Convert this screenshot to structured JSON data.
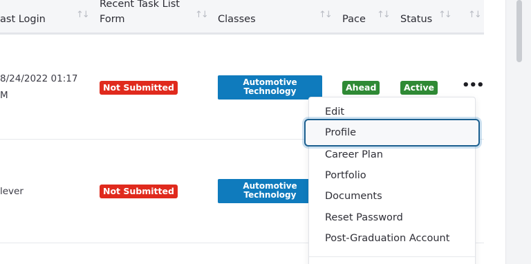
{
  "table": {
    "columns": [
      {
        "label": "ast Login"
      },
      {
        "label_line1": "Recent Task List",
        "label_line2": "Form"
      },
      {
        "label": "Classes"
      },
      {
        "label": "Pace"
      },
      {
        "label": "Status"
      }
    ],
    "rows": [
      {
        "last_login_line1": "8/24/2022 01:17",
        "last_login_line2": "M",
        "task_form": "Not Submitted",
        "class_line1": "Automotive",
        "class_line2": "Technology",
        "pace": "Ahead",
        "status": "Active"
      },
      {
        "last_login": "lever",
        "task_form": "Not Submitted",
        "class_line1": "Automotive",
        "class_line2": "Technology"
      }
    ]
  },
  "actions_menu": {
    "items": [
      {
        "label": "Edit"
      },
      {
        "label": "Profile"
      },
      {
        "label": "Career Plan"
      },
      {
        "label": "Portfolio"
      },
      {
        "label": "Documents"
      },
      {
        "label": "Reset Password"
      },
      {
        "label": "Post-Graduation Account"
      }
    ],
    "focused_item": "Profile"
  },
  "sort_glyph": "↑↓",
  "more_glyph": "•••",
  "icons": {
    "sort": "sort-arrows-icon",
    "more": "more-horizontal-icon"
  },
  "colors": {
    "not_submitted": "#e02a1d",
    "class_badge": "#0f7bbd",
    "pace_badge": "#2f8a35",
    "status_badge": "#2f8a35",
    "focus_ring": "#1b5f8f"
  }
}
